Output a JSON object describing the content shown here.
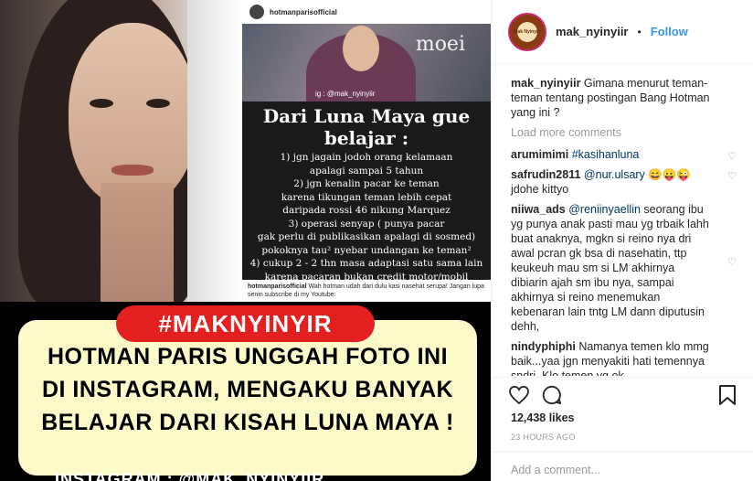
{
  "post_image": {
    "screenshot": {
      "username": "hotmanparisofficial",
      "watermark": "moei",
      "ig_tag": "ig : @mak_nyinyiir",
      "title": "Dari Luna Maya gue belajar :",
      "lines": [
        "1)  jgn jagain jodoh orang kelamaan",
        "apalagi sampai 5 tahun",
        "2) jgn kenalin pacar ke teman",
        "karena tikungan teman lebih cepat",
        "daripada rossi 46 nikung Marquez",
        "3) operasi senyap ( punya pacar",
        "gak perlu di publikasikan apalagi di sosmed)",
        "pokoknya tau² nyebar undangan ke teman²",
        "4) cukup 2 - 2 thn masa adaptasi satu sama lain",
        "karena pacaran bukan credit motor/mobil"
      ],
      "caption_user": "hotmanparisofficial",
      "caption_text": "Wah hotman udah dari dulu kasi nasehat serupa! Jangan lupa senin subscribe di my Youtube:"
    },
    "hashtag": "#MAKNYINYIR",
    "headline": [
      "HOTMAN PARIS UNGGAH FOTO INI",
      "DI INSTAGRAM, MENGAKU BANYAK",
      "BELAJAR DARI KISAH LUNA MAYA !"
    ],
    "source": "INSTAGRAM : @MAK_NYINYIIR"
  },
  "sidebar": {
    "avatar_text": "Mak Nyinyiir",
    "username": "mak_nyinyiir",
    "dot": "•",
    "follow_label": "Follow",
    "caption": {
      "user": "mak_nyinyiir",
      "text": "Gimana menurut teman-teman tentang postingan Bang Hotman yang ini ?"
    },
    "load_more": "Load more comments",
    "comments": [
      {
        "user": "arumimimi",
        "mention": "#kasihanluna",
        "text": "",
        "heart": true
      },
      {
        "user": "safrudin2811",
        "mention": "@nur.ulsary",
        "text": "😄😛😜 jdohe kittyo",
        "heart": true
      },
      {
        "user": "niiwa_ads",
        "mention": "@reniinyaellin",
        "text": "seorang ibu yg punya anak pasti mau yg trbaik lahh buat anaknya, mgkn si reino nya dri awal pcran gk bsa di nasehatin, ttp keukeuh mau sm si LM akhirnya dibiarin ajah sm ibu nya, sampai akhirnya si reino menemukan kebenaran lain tntg LM dann diputusin dehh,",
        "heart": true
      },
      {
        "user": "nindyphiphi",
        "mention": "",
        "text": "Namanya temen klo mmg baik...yaa jgn menyakiti hati temennya sndri. Klo temen yg ok",
        "heart": false
      }
    ],
    "likes": "12,438 likes",
    "timestamp": "23 HOURS AGO",
    "add_comment_placeholder": "Add a comment..."
  },
  "icons": [
    "heart-icon",
    "comment-icon",
    "share-icon",
    "bookmark-icon"
  ]
}
